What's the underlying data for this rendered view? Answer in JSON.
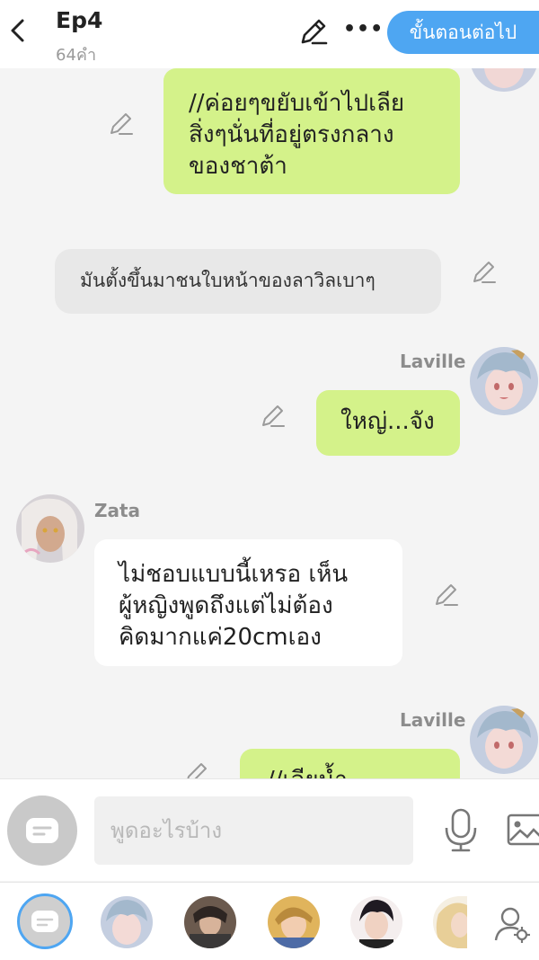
{
  "header": {
    "title": "Ep4",
    "word_count": "64คำ",
    "next_button": "ขั้นตอนต่อไป"
  },
  "messages": [
    {
      "type": "narration",
      "lines": [
        "//ค่อยๆขยับเข้าไปเลีย",
        "สิ่งๆนั่นที่อยู่ตรงกลาง",
        "ของชาต้า"
      ]
    },
    {
      "type": "system",
      "text": "มันตั้งขึ้นมาชนใบหน้าของลาวิลเบาๆ"
    },
    {
      "type": "right",
      "speaker": "Laville",
      "text": "ใหญ่...จัง"
    },
    {
      "type": "left",
      "speaker": "Zata",
      "lines": [
        "ไม่ชอบแบบนี้เหรอ  เห็น",
        "ผู้หญิงพูดถึงแต่ไม่ต้อง",
        "คิดมากแค่20cmเอง"
      ]
    },
    {
      "type": "right",
      "speaker": "Laville",
      "text": "//เลียน้ำ"
    }
  ],
  "input": {
    "placeholder": "พูดอะไรบ้าง"
  },
  "icons": {
    "back": "chevron-left-icon",
    "edit": "pencil-icon",
    "more": "ellipsis-icon",
    "chat": "chat-bubble-icon",
    "mic": "microphone-icon",
    "image": "image-icon",
    "cast": "user-settings-icon"
  },
  "colors": {
    "accent": "#4ea6f2",
    "bubble_green": "#d4f28a",
    "bubble_white": "#ffffff",
    "bubble_grey": "#e8e8e8",
    "name_grey": "#8c8c8c"
  }
}
